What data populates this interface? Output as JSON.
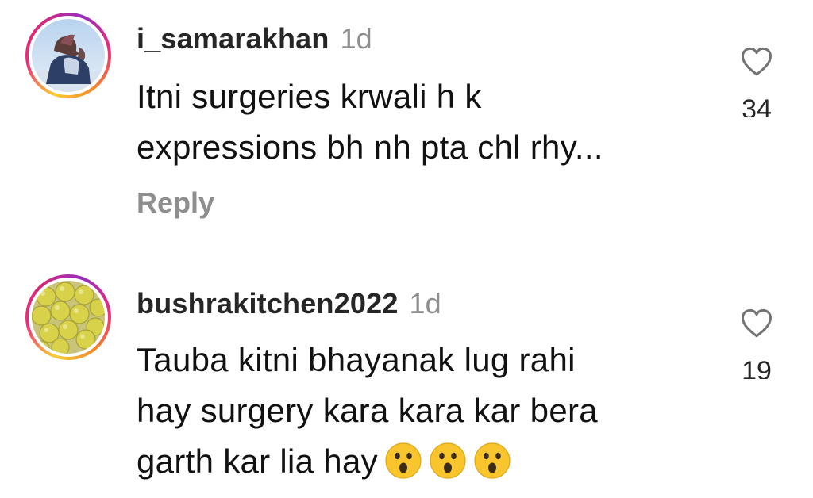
{
  "comments": [
    {
      "username": "i_samarakhan",
      "time": "1d",
      "text_lines": [
        "Itni surgeries krwali h k",
        "expressions bh nh pta chl rhy..."
      ],
      "reply_label": "Reply",
      "like_count": "34",
      "avatar": "profile-photo-person-outdoors"
    },
    {
      "username": "bushrakitchen2022",
      "time": "1d",
      "text_lines": [
        "Tauba kitni bhayanak lug rahi",
        "hay surgery kara kara kar bera",
        "garth kar lia hay"
      ],
      "emojis": [
        "hushed-face-emoji",
        "hushed-face-emoji",
        "hushed-face-emoji"
      ],
      "like_count": "19",
      "avatar": "profile-photo-yellow-fruits"
    }
  ],
  "colors": {
    "username": "#262626",
    "secondary_text": "#8e8e8e",
    "story_ring_start": "#f9ce34",
    "story_ring_mid": "#ee2a7b",
    "story_ring_end": "#962fbf"
  }
}
